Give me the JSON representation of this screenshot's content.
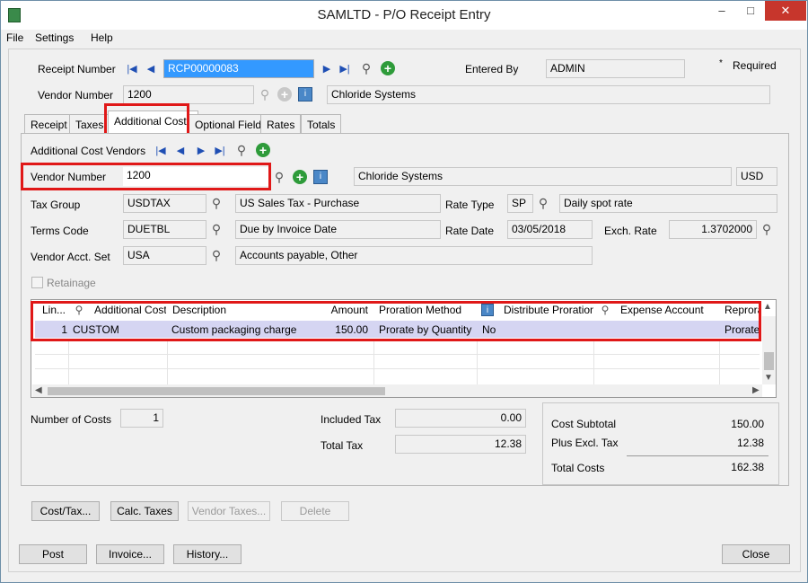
{
  "window": {
    "title": "SAMLTD - P/O Receipt Entry",
    "minimize": "–",
    "maximize": "□",
    "close": "✕"
  },
  "menu": {
    "file": "File",
    "settings": "Settings",
    "help": "Help"
  },
  "header": {
    "receipt_label": "Receipt Number",
    "receipt_value": "RCP00000083",
    "entered_by_label": "Entered By",
    "entered_by_value": "ADMIN",
    "required_label": "Required",
    "vendor_label": "Vendor Number",
    "vendor_value": "1200",
    "vendor_name": "Chloride Systems"
  },
  "tabs": [
    "Receipt",
    "Taxes",
    "Additional Costs",
    "Optional Fields",
    "Rates",
    "Totals"
  ],
  "active_tab": "Additional Costs",
  "addl": {
    "vendors_label": "Additional Cost Vendors",
    "vendor_label": "Vendor Number",
    "vendor_value": "1200",
    "vendor_name": "Chloride Systems",
    "currency": "USD",
    "tax_group_label": "Tax Group",
    "tax_group_value": "USDTAX",
    "tax_group_desc": "US Sales Tax - Purchase",
    "rate_type_label": "Rate Type",
    "rate_type_value": "SP",
    "rate_type_desc": "Daily spot rate",
    "terms_label": "Terms Code",
    "terms_value": "DUETBL",
    "terms_desc": "Due by Invoice Date",
    "rate_date_label": "Rate Date",
    "rate_date_value": "03/05/2018",
    "exch_rate_label": "Exch. Rate",
    "exch_rate_value": "1.3702000",
    "acct_set_label": "Vendor Acct. Set",
    "acct_set_value": "USA",
    "acct_set_desc": "Accounts payable, Other",
    "retainage_label": "Retainage"
  },
  "grid": {
    "headers": [
      "Lin...",
      "Additional Cost",
      "Description",
      "Amount",
      "Proration Method",
      "Distribute Proration",
      "Expense Account",
      "Reprora"
    ],
    "rows": [
      {
        "line": "1",
        "cost": "CUSTOM",
        "desc": "Custom packaging charge",
        "amount": "150.00",
        "method": "Prorate by Quantity",
        "distribute": "No",
        "expense": "",
        "reprorate": "Prorate"
      }
    ]
  },
  "summary": {
    "num_costs_label": "Number of Costs",
    "num_costs_value": "1",
    "included_tax_label": "Included Tax",
    "included_tax_value": "0.00",
    "total_tax_label": "Total Tax",
    "total_tax_value": "12.38",
    "cost_subtotal_label": "Cost Subtotal",
    "cost_subtotal_value": "150.00",
    "plus_excl_tax_label": "Plus Excl. Tax",
    "plus_excl_tax_value": "12.38",
    "total_costs_label": "Total Costs",
    "total_costs_value": "162.38"
  },
  "tab_buttons": {
    "cost_tax": "Cost/Tax...",
    "calc_taxes": "Calc. Taxes",
    "vendor_taxes": "Vendor Taxes...",
    "delete": "Delete"
  },
  "footer_buttons": {
    "post": "Post",
    "invoice": "Invoice...",
    "history": "History...",
    "close": "Close"
  }
}
